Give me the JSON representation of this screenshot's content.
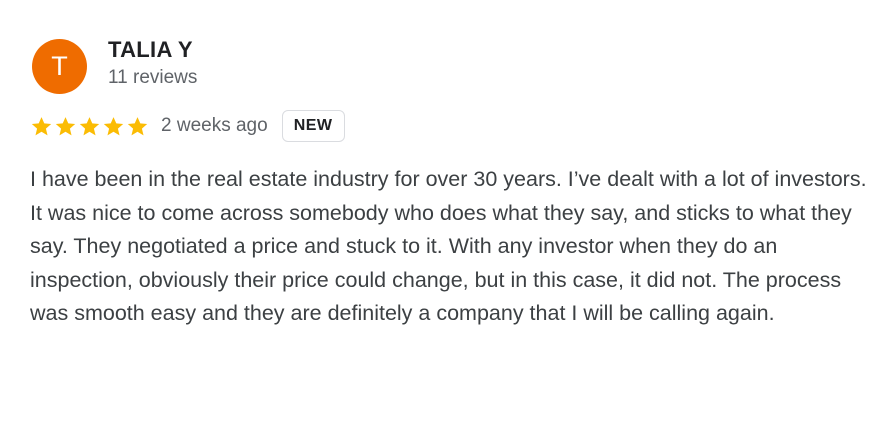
{
  "reviewer": {
    "initial": "T",
    "name": "TALIA Y",
    "review_count": "11 reviews",
    "avatar_color": "#EF6C00"
  },
  "rating": {
    "stars": 5,
    "max_stars": 5,
    "star_color": "#FBBC04",
    "star_icon": "star-icon"
  },
  "meta": {
    "date": "2 weeks ago",
    "badge": "NEW"
  },
  "review": {
    "text": "I have been in the real estate industry for over 30 years. I’ve dealt with a lot of investors. It was nice to come across somebody who does what they say, and sticks to what they say. They negotiated a price and stuck to it. With any investor when they do an inspection, obviously their price could change, but in this case, it did not. The process was smooth easy and they are definitely a company that I will be calling again."
  }
}
